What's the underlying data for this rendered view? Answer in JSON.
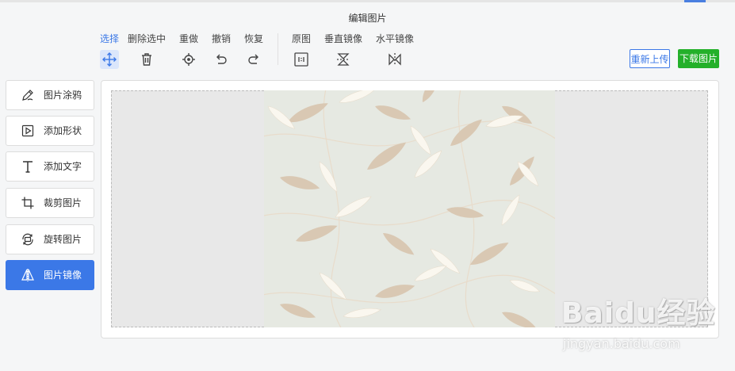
{
  "header": {
    "title": "编辑图片"
  },
  "toolbar": {
    "tools": [
      {
        "label": "选择",
        "icon": "move-icon",
        "active": true
      },
      {
        "label": "删除选中",
        "icon": "trash-icon"
      },
      {
        "label": "重做",
        "icon": "crosshair-icon"
      },
      {
        "label": "撤销",
        "icon": "undo-icon"
      },
      {
        "label": "恢复",
        "icon": "redo-icon"
      },
      {
        "label": "原图",
        "icon": "original-size-icon"
      },
      {
        "label": "垂直镜像",
        "icon": "flip-vertical-icon"
      },
      {
        "label": "水平镜像",
        "icon": "flip-horizontal-icon"
      }
    ],
    "upload_label": "重新上传",
    "download_label": "下载图片"
  },
  "sidebar": {
    "items": [
      {
        "label": "图片涂鸦",
        "icon": "pen-icon"
      },
      {
        "label": "添加形状",
        "icon": "shape-icon"
      },
      {
        "label": "添加文字",
        "icon": "text-icon"
      },
      {
        "label": "裁剪图片",
        "icon": "crop-icon"
      },
      {
        "label": "旋转图片",
        "icon": "rotate-icon"
      },
      {
        "label": "图片镜像",
        "icon": "mirror-icon",
        "active": true
      }
    ]
  },
  "watermark": {
    "logo": "Baidu经验",
    "url": "jingyan.baidu.com"
  },
  "colors": {
    "accent": "#3b78e7",
    "download": "#24b02a",
    "leaf_tan": "#d9c8b3",
    "leaf_white": "#faf7ef",
    "pattern_bg": "#e6e9e2"
  }
}
